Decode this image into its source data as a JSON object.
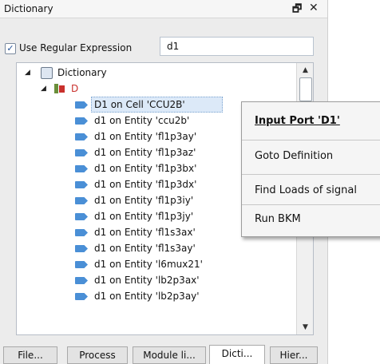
{
  "panel": {
    "title": "Dictionary"
  },
  "regex": {
    "checkbox_label": "Use Regular Expression",
    "checked": true,
    "checkmark": "✓",
    "value": "d1"
  },
  "tree": {
    "root_label": "Dictionary",
    "child_label": "D",
    "child_color": "#c9302c",
    "leaf_color": "#4a8fd6",
    "items": [
      "D1 on Cell 'CCU2B'",
      "d1 on Entity 'ccu2b'",
      "d1 on Entity 'fl1p3ay'",
      "d1 on Entity 'fl1p3az'",
      "d1 on Entity 'fl1p3bx'",
      "d1 on Entity 'fl1p3dx'",
      "d1 on Entity 'fl1p3iy'",
      "d1 on Entity 'fl1p3jy'",
      "d1 on Entity 'fl1s3ax'",
      "d1 on Entity 'fl1s3ay'",
      "d1 on Entity 'l6mux21'",
      "d1 on Entity 'lb2p3ax'",
      "d1 on Entity 'lb2p3ay'"
    ],
    "selected_index": 0
  },
  "context_menu": {
    "items": [
      "Input Port 'D1'",
      "Goto Definition",
      "Find Loads of signal",
      "Run BKM"
    ]
  },
  "tabs": [
    "File...",
    "Process",
    "Module li...",
    "Dicti...",
    "Hier..."
  ],
  "active_tab": 3
}
